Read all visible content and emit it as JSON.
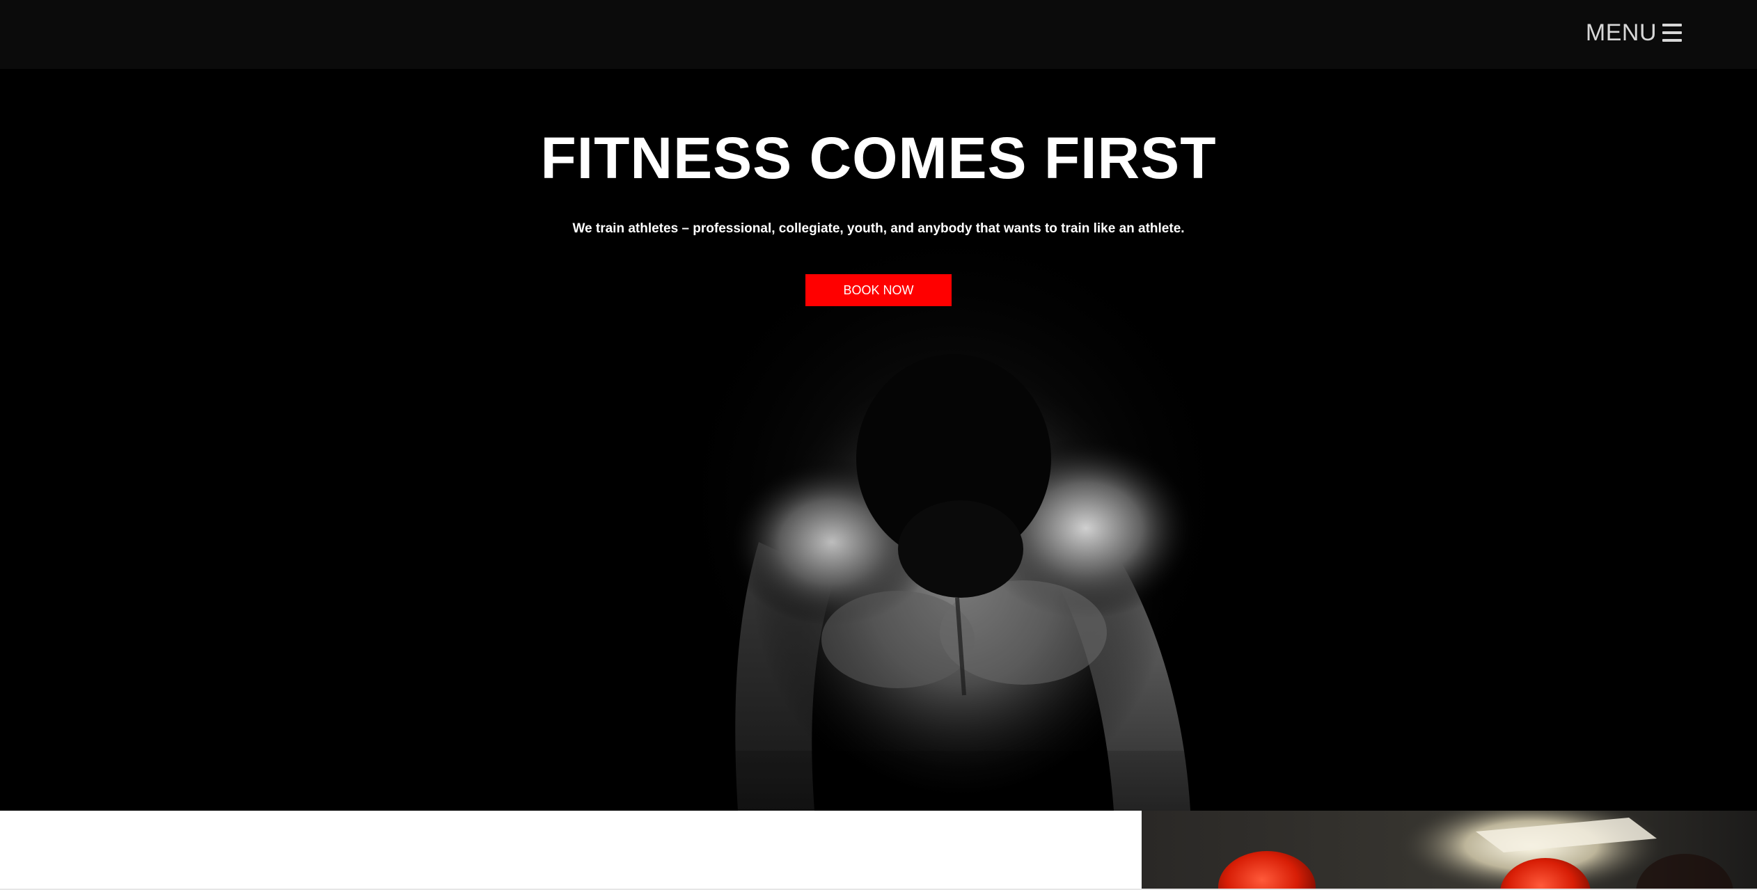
{
  "header": {
    "menu_label": "MENU",
    "menu_icon": "hamburger-icon"
  },
  "hero": {
    "title": "FITNESS COMES FIRST",
    "subtitle": "We train athletes – professional, collegiate, youth, and anybody that wants to train like an athlete.",
    "cta_label": "BOOK NOW",
    "background_image": "athlete-silhouette-photo"
  },
  "lower_section": {
    "image": "boxing-gloves-photo"
  },
  "colors": {
    "header_bg": "#0b0b0b",
    "hero_bg": "#000000",
    "accent": "#ff0000",
    "text": "#ffffff",
    "menu_text": "#d8d8d8"
  }
}
